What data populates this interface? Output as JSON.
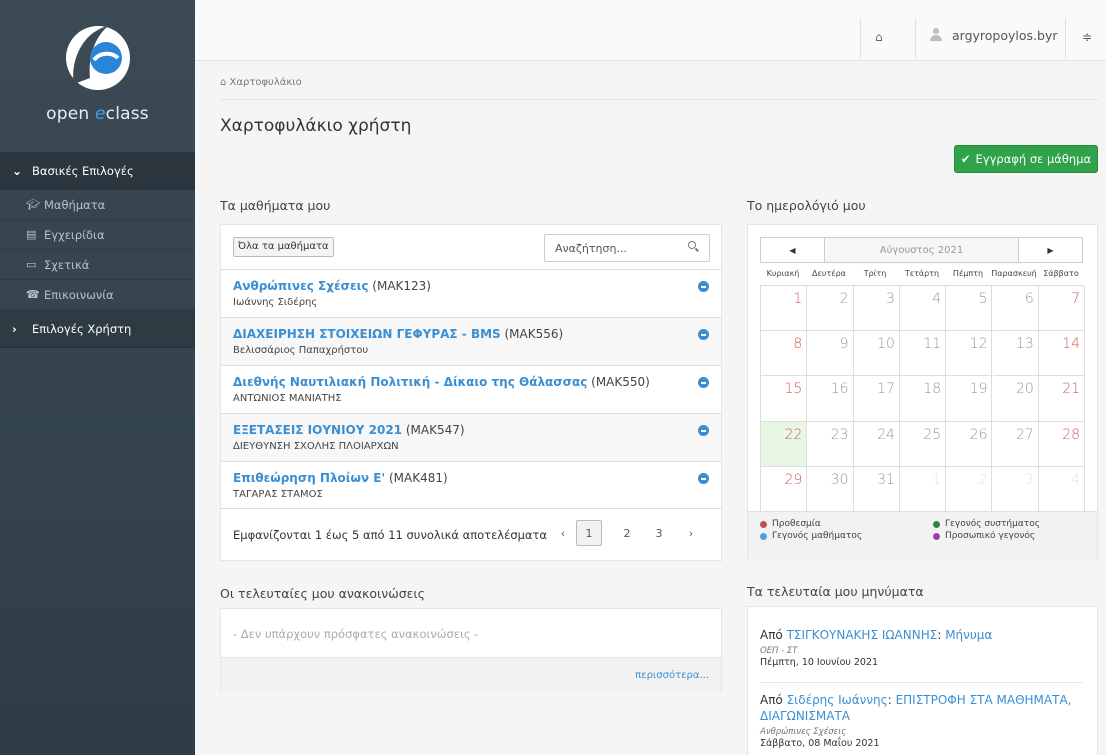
{
  "sidebar": {
    "logo_text_prefix": "open ",
    "logo_text_accent": "e",
    "logo_text_suffix": "class",
    "section_basic": "Βασικές Επιλογές",
    "items": [
      {
        "label": "Μαθήματα",
        "icon": "graduation-cap-icon"
      },
      {
        "label": "Εγχειρίδια",
        "icon": "document-icon"
      },
      {
        "label": "Σχετικά",
        "icon": "card-icon"
      },
      {
        "label": "Επικοινωνία",
        "icon": "phone-icon"
      }
    ],
    "section_user": "Επιλογές Χρήστη"
  },
  "topbar": {
    "username": "argyropoylos.byr"
  },
  "breadcrumb": "Χαρτοφυλάκιο",
  "page_title": "Χαρτοφυλάκιο χρήστη",
  "enroll_button": "Εγγραφή σε μάθημα",
  "courses": {
    "title": "Τα μαθήματα μου",
    "all_button": "Όλα τα μαθήματα",
    "search_placeholder": "Αναζήτηση...",
    "rows": [
      {
        "name": "Ανθρώπινες Σχέσεις",
        "code": " (MAK123)",
        "teacher": "Ιωάννης Σιδέρης"
      },
      {
        "name": "ΔΙΑΧΕΙΡΗΣΗ ΣΤΟΙΧΕΙΩΝ ΓΕΦΥΡΑΣ - BMS",
        "code": " (MAK556)",
        "teacher": "Βελισσάριος Παπαχρήστου"
      },
      {
        "name": "Διεθνής Ναυτιλιακή Πολιτική - Δίκαιο της Θάλασσας",
        "code": " (MAK550)",
        "teacher": "ΑΝΤΩΝΙΟΣ ΜΑΝΙΑΤΗΣ"
      },
      {
        "name": "ΕΞΕΤΑΣΕΙΣ ΙΟΥΝΙΟΥ 2021",
        "code": " (MAK547)",
        "teacher": "ΔΙΕΥΘΥΝΣΗ ΣΧΟΛΗΣ ΠΛΟΙΑΡΧΩΝ"
      },
      {
        "name": "Επιθεώρηση Πλοίων Ε'",
        "code": " (MAK481)",
        "teacher": "ΤΑΓΑΡΑΣ ΣΤΑΜΟΣ"
      }
    ],
    "pager_info": "Εμφανίζονται 1 έως 5 από 11 συνολικά αποτελέσματα",
    "pages": [
      "‹",
      "1",
      "2",
      "3",
      "›"
    ],
    "active_page": "1"
  },
  "calendar": {
    "title": "Το ημερολόγιό μου",
    "prev": "◀",
    "next": "▶",
    "month": "Αύγουστος 2021",
    "weekdays": [
      "Κυριακή",
      "Δευτέρα",
      "Τρίτη",
      "Τετάρτη",
      "Πέμπτη",
      "Παρασκευή",
      "Σάββατο"
    ],
    "weeks": [
      [
        "1",
        "2",
        "3",
        "4",
        "5",
        "6",
        "7"
      ],
      [
        "8",
        "9",
        "10",
        "11",
        "12",
        "13",
        "14"
      ],
      [
        "15",
        "16",
        "17",
        "18",
        "19",
        "20",
        "21"
      ],
      [
        "22",
        "23",
        "24",
        "25",
        "26",
        "27",
        "28"
      ],
      [
        "29",
        "30",
        "31",
        "1",
        "2",
        "3",
        "4"
      ]
    ],
    "today": "22",
    "legend": [
      {
        "label": "Προθεσμία",
        "color": "#c0504d"
      },
      {
        "label": "Γεγονός συστήματος",
        "color": "#2e8b3d"
      },
      {
        "label": "Γεγονός μαθήματος",
        "color": "#4a9fe4"
      },
      {
        "label": "Προσωπικό γεγονός",
        "color": "#9b3fb0"
      }
    ]
  },
  "announcements": {
    "title": "Οι τελευταίες μου ανακοινώσεις",
    "empty": "- Δεν υπάρχουν πρόσφατες ανακοινώσεις -",
    "more": "περισσότερα..."
  },
  "messages": {
    "title": "Τα τελευταία μου μηνύματα",
    "items": [
      {
        "from_prefix": "Από ",
        "sender": "ΤΣΙΓΚΟΥΝΑΚΗΣ ΙΩΑΝΝΗΣ",
        "sep": ": ",
        "subject": "Μήνυμα",
        "course": "ΟΕΠ - ΣΤ",
        "date": "Πέμπτη, 10 Ιουνίου 2021"
      },
      {
        "from_prefix": "Από ",
        "sender": "Σιδέρης Ιωάννης",
        "sep": ": ",
        "subject": "ΕΠΙΣΤΡΟΦΗ ΣΤΑ ΜΑΘΗΜΑΤΑ, ΔΙΑΓΩΝΙΣΜΑΤΑ",
        "course": "Ανθρώπινες Σχέσεις",
        "date": "Σάββατο, 08 Μαΐου 2021"
      }
    ]
  }
}
